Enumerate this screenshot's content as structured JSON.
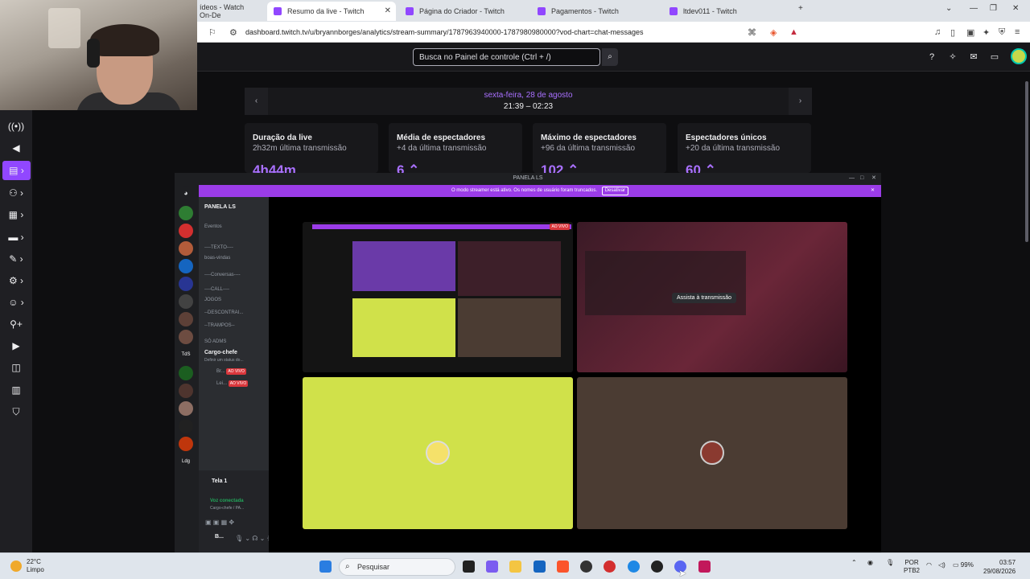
{
  "browser": {
    "tabs": [
      {
        "title": "ídeos - Watch On-De",
        "active": false
      },
      {
        "title": "Resumo da live - Twitch",
        "active": true
      },
      {
        "title": "Página do Criador - Twitch",
        "active": false
      },
      {
        "title": "Pagamentos - Twitch",
        "active": false
      },
      {
        "title": "ltdev011 - Twitch",
        "active": false
      }
    ],
    "url": "dashboard.twitch.tv/u/bryannborges/analytics/stream-summary/1787963940000-1787980980000?vod-chart=chat-messages"
  },
  "twitch": {
    "search_placeholder": "Busca no Painel de controle (Ctrl + /)",
    "summary": {
      "date": "sexta-feira, 28 de agosto",
      "time": "21:39 – 02:23"
    },
    "cards": [
      {
        "title": "Duração da live",
        "sub": "2h32m última transmissão",
        "value": "4h44m"
      },
      {
        "title": "Média de espectadores",
        "sub": "+4 da última transmissão",
        "value": "6 ⌃"
      },
      {
        "title": "Máximo de espectadores",
        "sub": "+96 da última transmissão",
        "value": "102 ⌃"
      },
      {
        "title": "Espectadores únicos",
        "sub": "+20 da última transmissão",
        "value": "60 ⌃"
      }
    ],
    "colors": {
      "accent": "#9147ff",
      "accent_text": "#a970ff",
      "bg": "#0e0e10"
    }
  },
  "discord": {
    "window_title": "PANELA LS",
    "banner_text": "O modo streamer está ativo. Os nomes de usuário foram truncados.",
    "banner_button": "Desativar",
    "server_name": "PANELA LS",
    "channels": {
      "eventos": "Eventos",
      "texto_header": "----TEXTO----",
      "boas_vindas": "boas-vindas",
      "conversas": "----Conversas----",
      "call_header": "----CALL----",
      "jogos": "JOGOS",
      "descontrai": "--DESCONTRAI...",
      "trampos": "--TRAMPOS--",
      "adms": "SÓ ADMS",
      "cargo_chefe": "Cargo-chefe",
      "cargo_status": "Definir um status do..."
    },
    "live_users": [
      {
        "name": "Br...",
        "badge": "AO VIVO"
      },
      {
        "name": "Lei...",
        "badge": "AO VIVO"
      }
    ],
    "server_labels": {
      "tds": "TdS",
      "ldg": "Ldg"
    },
    "screen_share": "Tela 1",
    "voice_status": "Voz conectada",
    "voice_channel": "Cargo-chefe / PA...",
    "user_short": "B...",
    "stream_badge": "AO VIVO",
    "watch_button": "Assista à transmissão"
  },
  "taskbar": {
    "temperature": "22°C",
    "weather": "Limpo",
    "search_label": "Pesquisar",
    "language": "POR",
    "layout": "PTB2",
    "battery": "99%",
    "time": "03:57",
    "date": "29/08/2026"
  }
}
